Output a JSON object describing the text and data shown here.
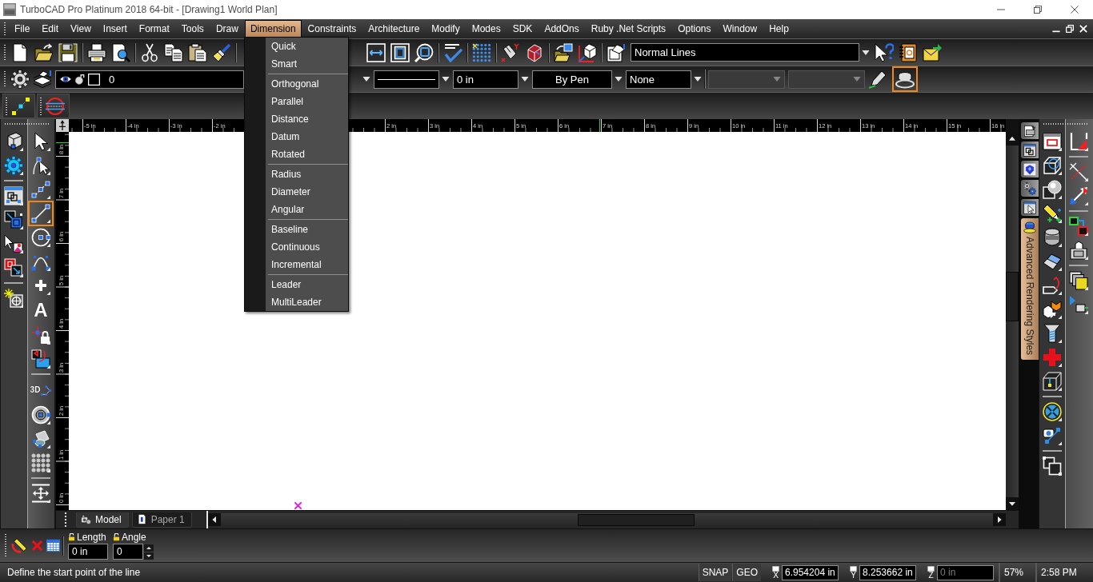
{
  "window": {
    "title": "TurboCAD Pro Platinum 2018 64-bit - [Drawing1 World Plan]"
  },
  "menu_bar": {
    "items": [
      {
        "label": "File",
        "selected": false
      },
      {
        "label": "Edit",
        "selected": false
      },
      {
        "label": "View",
        "selected": false
      },
      {
        "label": "Insert",
        "selected": false
      },
      {
        "label": "Format",
        "selected": false
      },
      {
        "label": "Tools",
        "selected": false
      },
      {
        "label": "Draw",
        "selected": false
      },
      {
        "label": "Dimension",
        "selected": true
      },
      {
        "label": "Constraints",
        "selected": false
      },
      {
        "label": "Architecture",
        "selected": false
      },
      {
        "label": "Modify",
        "selected": false
      },
      {
        "label": "Modes",
        "selected": false
      },
      {
        "label": "SDK",
        "selected": false
      },
      {
        "label": "AddOns",
        "selected": false
      },
      {
        "label": "Ruby .Net Scripts",
        "selected": false
      },
      {
        "label": "Options",
        "selected": false
      },
      {
        "label": "Window",
        "selected": false
      },
      {
        "label": "Help",
        "selected": false
      }
    ]
  },
  "dimension_menu": {
    "items": [
      {
        "kind": "item",
        "label": "Quick"
      },
      {
        "kind": "item",
        "label": "Smart"
      },
      {
        "kind": "separator"
      },
      {
        "kind": "item",
        "label": "Orthogonal"
      },
      {
        "kind": "item",
        "label": "Parallel"
      },
      {
        "kind": "item",
        "label": "Distance"
      },
      {
        "kind": "item",
        "label": "Datum"
      },
      {
        "kind": "item",
        "label": "Rotated"
      },
      {
        "kind": "separator"
      },
      {
        "kind": "item",
        "label": "Radius"
      },
      {
        "kind": "item",
        "label": "Diameter"
      },
      {
        "kind": "item",
        "label": "Angular"
      },
      {
        "kind": "separator"
      },
      {
        "kind": "item",
        "label": "Baseline"
      },
      {
        "kind": "item",
        "label": "Continuous"
      },
      {
        "kind": "item",
        "label": "Incremental"
      },
      {
        "kind": "separator"
      },
      {
        "kind": "item",
        "label": "Leader"
      },
      {
        "kind": "item",
        "label": "MultiLeader"
      }
    ]
  },
  "standard_toolbar": {
    "style_dropdown": {
      "value": "Normal Lines"
    }
  },
  "property_toolbar": {
    "dropdowns": [
      {
        "kind": "layer",
        "value": "0",
        "disabled": false
      },
      {
        "kind": "line",
        "disabled": false
      },
      {
        "kind": "text",
        "value": "0 in",
        "disabled": false
      },
      {
        "kind": "button",
        "value": "By Pen",
        "disabled": false
      },
      {
        "kind": "text",
        "value": "None",
        "disabled": false
      },
      {
        "kind": "text",
        "disabled": true
      },
      {
        "kind": "text",
        "disabled": true
      }
    ],
    "tool_buttons": [
      {
        "selected": false
      },
      {
        "selected": true
      }
    ]
  },
  "drawing_toolbox": {
    "tools": [
      {
        "selected": false
      },
      {
        "selected": false
      },
      {
        "selected": false
      },
      {
        "selected": true
      },
      {
        "selected": false
      },
      {
        "selected": false
      },
      {
        "selected": false
      },
      {
        "selected": false,
        "glyph": "A"
      },
      {
        "selected": false
      },
      {
        "selected": false
      },
      {
        "selected": false,
        "glyph": "3D"
      },
      {
        "selected": false
      },
      {
        "selected": false
      },
      {
        "selected": false
      },
      {
        "selected": false
      }
    ]
  },
  "top_ruler": {
    "left_labels": [
      "-5 in",
      "-4 in",
      "-3 in",
      "-2 in"
    ],
    "right_labels": [
      "2 in",
      "3 in",
      "4 in",
      "5 in",
      "6 in",
      "7 in",
      "8 in",
      "9 in",
      "10 in",
      "11 in",
      "12 in",
      "13 in",
      "14 in",
      "15 in",
      "16 in"
    ]
  },
  "side_ruler": {
    "labels": [
      "8 in",
      "7 in",
      "6 in",
      "5 in",
      "4 in",
      "3 in",
      "2 in",
      "1 in",
      "0 in"
    ]
  },
  "layout_tabs": [
    {
      "label": "Model",
      "selected": true
    },
    {
      "label": "Paper 1",
      "selected": false
    }
  ],
  "side_panel": {
    "tabs": [
      {
        "kind": "icon",
        "selected": false
      },
      {
        "kind": "icon",
        "selected": false
      },
      {
        "kind": "icon",
        "selected": false
      },
      {
        "kind": "icon",
        "selected": false
      },
      {
        "kind": "icon",
        "selected": false
      },
      {
        "kind": "text",
        "label": "Advanced Rendering Styles",
        "selected": true
      }
    ]
  },
  "inspector_bar": {
    "fields": [
      {
        "kind": "text",
        "label": "Length",
        "value": "0 in"
      },
      {
        "kind": "spinner",
        "label": "Angle",
        "value": "0"
      }
    ]
  },
  "status_bar": {
    "prompt": "Define the start point of the line",
    "toggles": [
      {
        "label": "SNAP"
      },
      {
        "label": "GEO"
      }
    ],
    "coordinates": [
      {
        "axis": "X",
        "value": "6.954204 in",
        "disabled": false
      },
      {
        "axis": "Y",
        "value": "8.253662 in",
        "disabled": false
      },
      {
        "axis": "Z",
        "value": "0 in",
        "disabled": true
      }
    ],
    "zoom": "57%",
    "time": "2:58 PM"
  }
}
